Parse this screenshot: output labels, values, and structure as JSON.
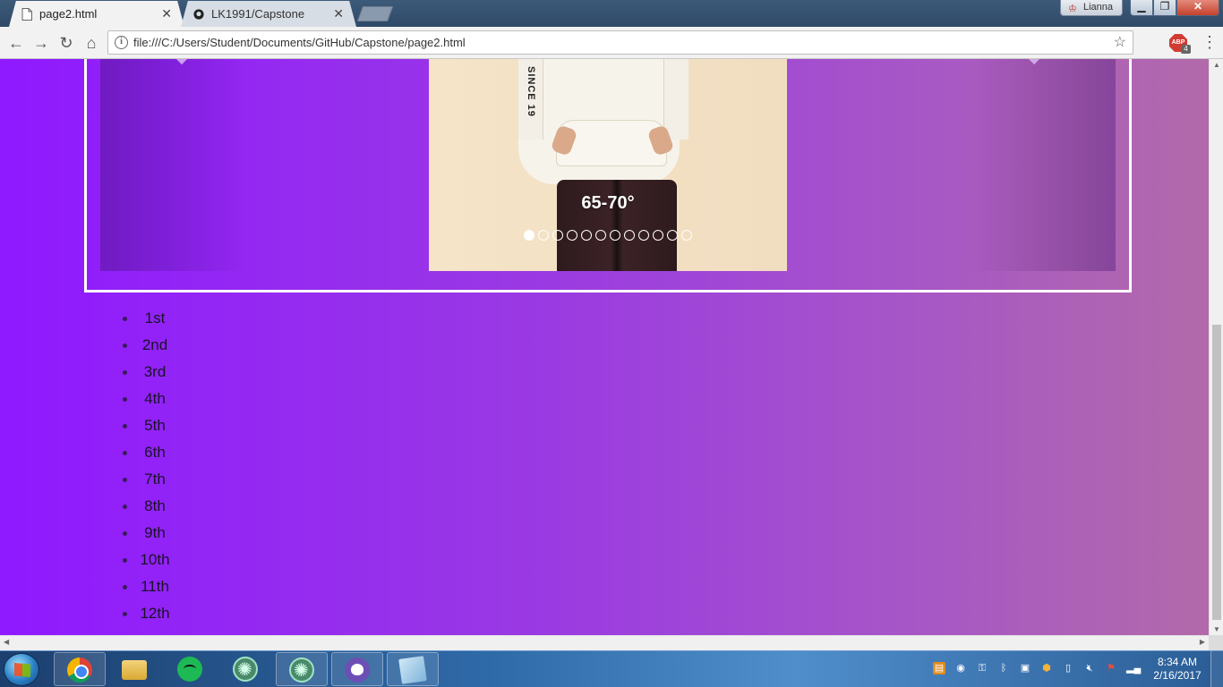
{
  "browser": {
    "tabs": [
      {
        "label": "page2.html",
        "icon": "document-icon",
        "active": true
      },
      {
        "label": "LK1991/Capstone",
        "icon": "github-icon",
        "active": false
      }
    ],
    "profile_name": "Lianna",
    "url": "file:///C:/Users/Student/Documents/GitHub/Capstone/page2.html",
    "extension_badge": "ABP",
    "extension_count": "4"
  },
  "page": {
    "carousel": {
      "caption": "65-70°",
      "slide_count": 12,
      "active_index": 0,
      "sleeve_text": "SINCE 19"
    },
    "grades": [
      "1st",
      "2nd",
      "3rd",
      "4th",
      "5th",
      "6th",
      "7th",
      "8th",
      "9th",
      "10th",
      "11th",
      "12th"
    ]
  },
  "taskbar": {
    "apps": [
      "chrome-icon",
      "file-explorer-icon",
      "spotify-icon",
      "atom-icon",
      "atom-icon",
      "github-desktop-icon",
      "notes-icon"
    ],
    "clock": {
      "time": "8:34 AM",
      "date": "2/16/2017"
    }
  },
  "colors": {
    "page_gradient_start": "#8f19ff",
    "page_gradient_end": "#b26aaa",
    "carousel_border": "#ffffff"
  }
}
